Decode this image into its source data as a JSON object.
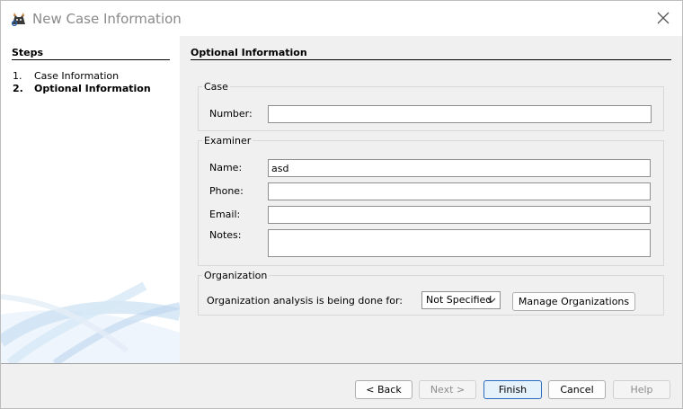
{
  "window": {
    "title": "New Case Information"
  },
  "steps": {
    "heading": "Steps",
    "items": [
      {
        "num": "1.",
        "label": "Case Information",
        "active": false
      },
      {
        "num": "2.",
        "label": "Optional Information",
        "active": true
      }
    ]
  },
  "panel": {
    "title": "Optional Information"
  },
  "case_group": {
    "label": "Case",
    "number_label": "Number:",
    "number_value": ""
  },
  "examiner_group": {
    "label": "Examiner",
    "name_label": "Name:",
    "name_value": "asd",
    "phone_label": "Phone:",
    "phone_value": "",
    "email_label": "Email:",
    "email_value": "",
    "notes_label": "Notes:",
    "notes_value": ""
  },
  "organization_group": {
    "label": "Organization",
    "prompt": "Organization analysis is being done for:",
    "selected": "Not Specified",
    "manage_label": "Manage Organizations"
  },
  "buttons": {
    "back": "< Back",
    "next": "Next >",
    "finish": "Finish",
    "cancel": "Cancel",
    "help": "Help"
  },
  "colors": {
    "accent": "#2a6bbf",
    "swoosh": "#c9dff2"
  }
}
